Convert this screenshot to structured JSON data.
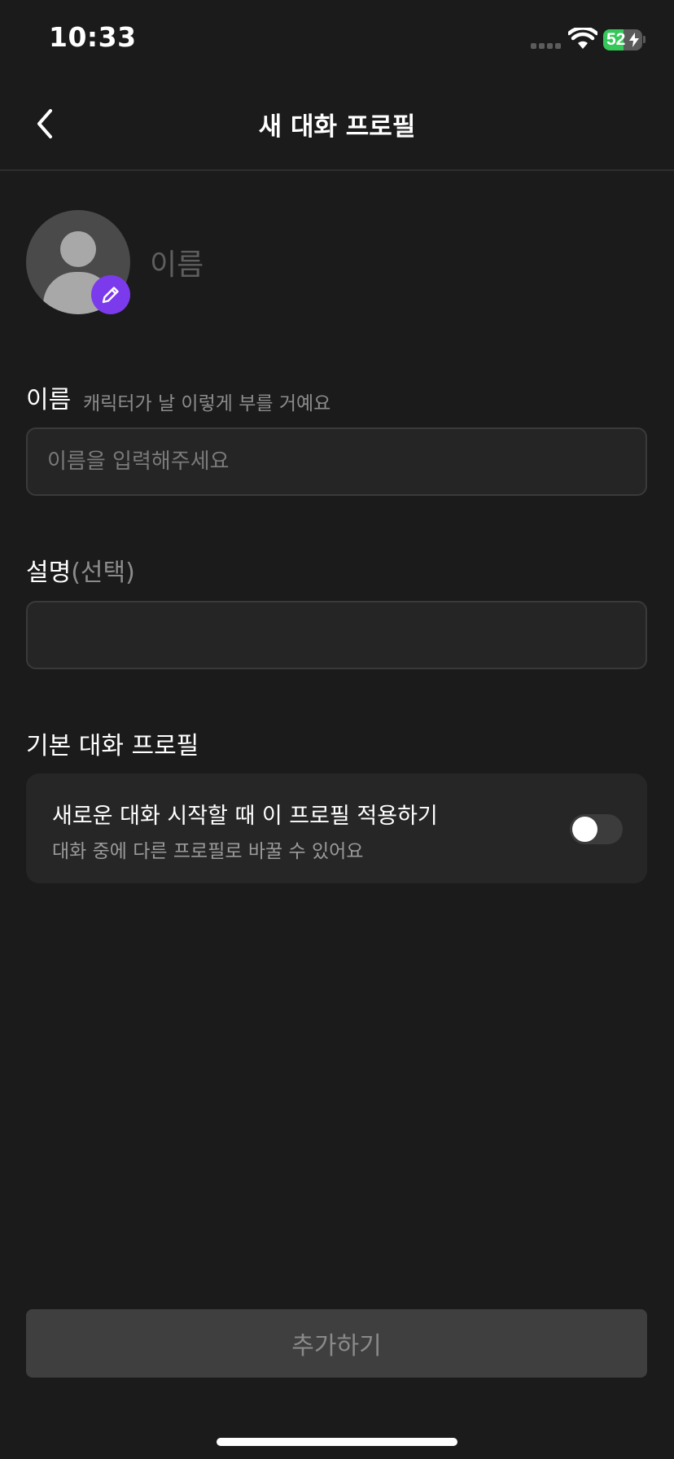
{
  "status_bar": {
    "time": "10:33",
    "battery_level": "52"
  },
  "nav": {
    "title": "새 대화 프로필",
    "back_icon": "chevron-left-icon"
  },
  "profile": {
    "name_preview": "이름",
    "avatar_icon": "person-icon",
    "edit_icon": "pencil-icon",
    "edit_badge_color": "#7c3aed"
  },
  "fields": {
    "name": {
      "label": "이름",
      "hint": "캐릭터가 날 이렇게 부를 거예요",
      "placeholder": "이름을 입력해주세요",
      "value": ""
    },
    "description": {
      "label": "설명",
      "optional": "(선택)",
      "value": ""
    }
  },
  "default_profile": {
    "label": "기본 대화 프로필",
    "card_title": "새로운 대화 시작할 때 이 프로필 적용하기",
    "card_subtitle": "대화 중에 다른 프로필로 바꿀 수 있어요",
    "toggle_on": false
  },
  "footer": {
    "add_label": "추가하기"
  }
}
